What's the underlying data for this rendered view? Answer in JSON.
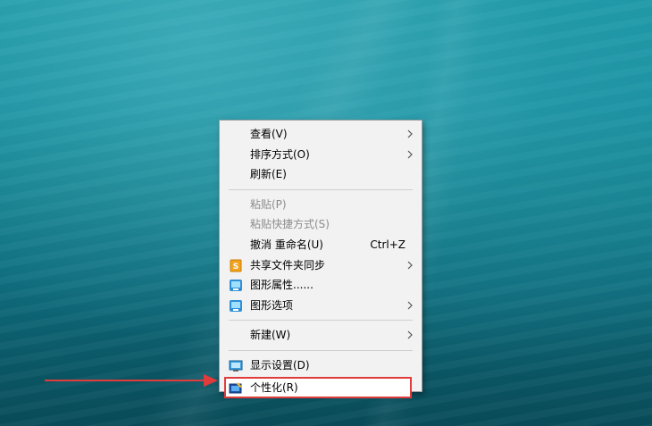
{
  "context_menu": {
    "items": [
      {
        "label": "查看(V)",
        "submenu": true
      },
      {
        "label": "排序方式(O)",
        "submenu": true
      },
      {
        "label": "刷新(E)"
      },
      {
        "label": "粘贴(P)",
        "disabled": true
      },
      {
        "label": "粘贴快捷方式(S)",
        "disabled": true
      },
      {
        "label": "撤消 重命名(U)",
        "shortcut": "Ctrl+Z"
      },
      {
        "label": "共享文件夹同步",
        "icon": "sync-folder-icon",
        "submenu": true
      },
      {
        "label": "图形属性......",
        "icon": "intel-graphics-icon"
      },
      {
        "label": "图形选项",
        "icon": "intel-graphics-icon",
        "submenu": true
      },
      {
        "label": "新建(W)",
        "submenu": true
      },
      {
        "label": "显示设置(D)",
        "icon": "display-icon"
      },
      {
        "label": "个性化(R)",
        "icon": "personalize-icon",
        "highlighted": true
      }
    ]
  },
  "annotation": {
    "highlight_color": "#e23b3b"
  }
}
